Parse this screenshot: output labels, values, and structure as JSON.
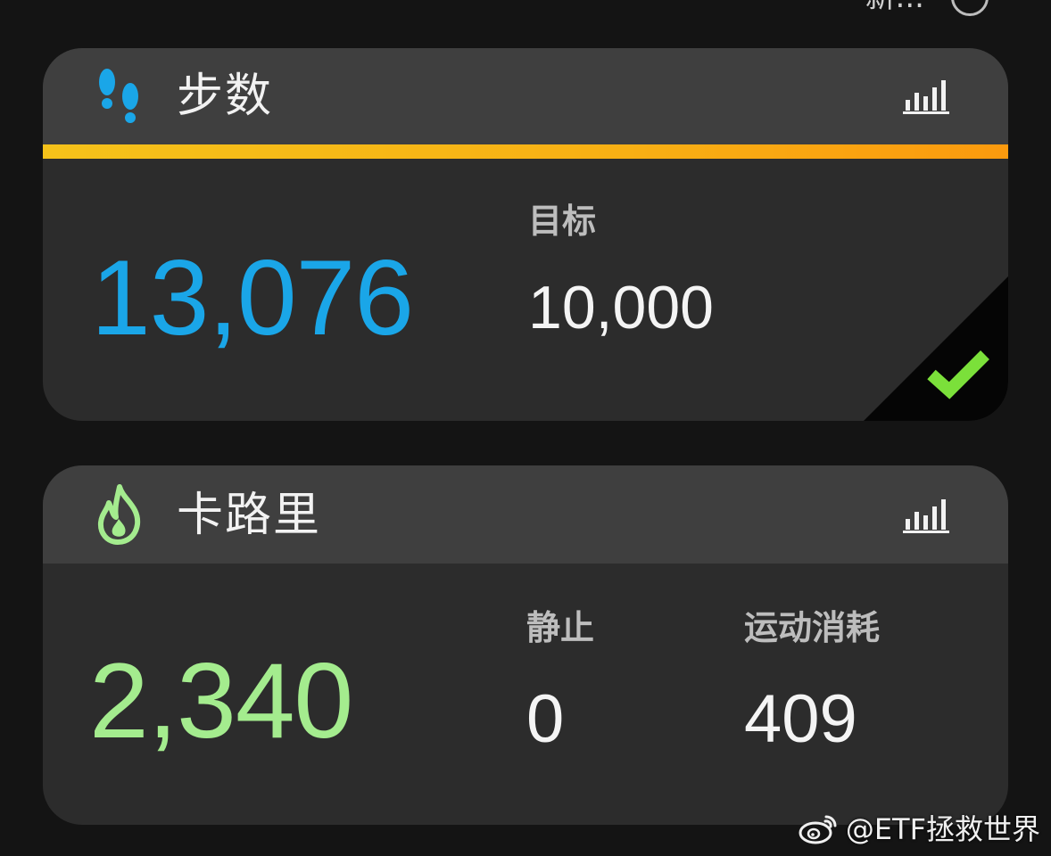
{
  "top_strip": {
    "cut_text": "新..."
  },
  "steps_card": {
    "title": "步数",
    "icon": "footprints-icon",
    "chart_icon": "bar-chart-icon",
    "accent_color": "#f8b014",
    "value": "13,076",
    "value_color": "#1aa6e8",
    "goal_label": "目标",
    "goal_value": "10,000",
    "goal_met": true,
    "goal_met_icon": "checkmark-icon"
  },
  "calories_card": {
    "title": "卡路里",
    "icon": "flame-icon",
    "chart_icon": "bar-chart-icon",
    "value": "2,340",
    "value_color": "#a4ec8e",
    "rest_label": "静止",
    "rest_value": "0",
    "active_label": "运动消耗",
    "active_value": "409"
  },
  "watermark": {
    "icon": "weibo-icon",
    "text": "@ETF拯救世界"
  }
}
